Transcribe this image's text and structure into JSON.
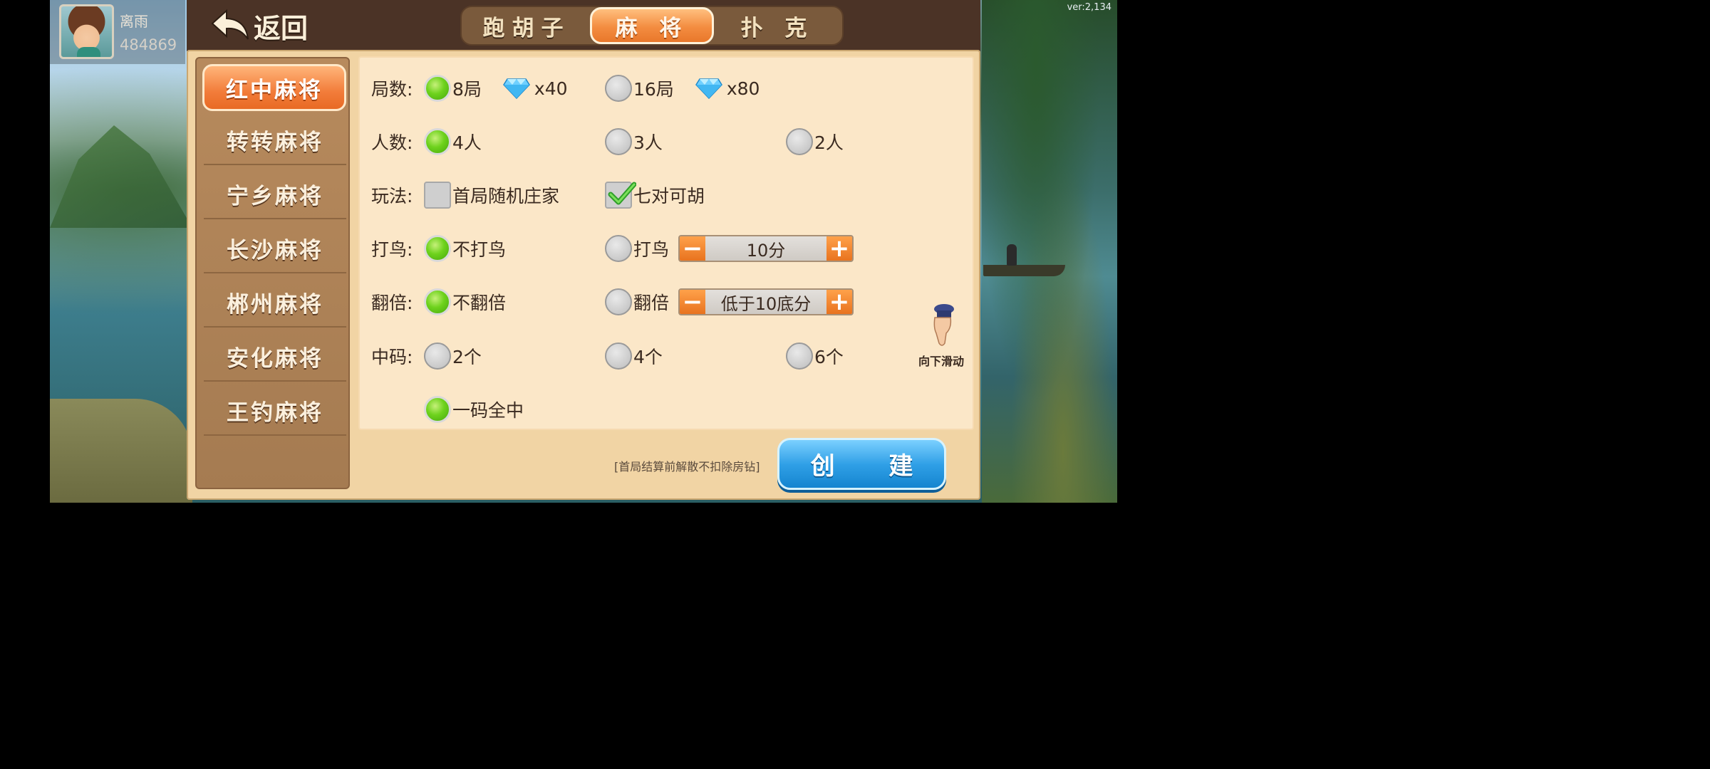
{
  "version": "ver:2,134",
  "player": {
    "name": "离雨",
    "id": "484869"
  },
  "header": {
    "back_label": "返回",
    "tabs": [
      {
        "label": "跑胡子",
        "active": false
      },
      {
        "label": "麻 将",
        "active": true
      },
      {
        "label": "扑 克",
        "active": false
      }
    ]
  },
  "sidebar": {
    "items": [
      {
        "label": "红中麻将",
        "active": true
      },
      {
        "label": "转转麻将",
        "active": false
      },
      {
        "label": "宁乡麻将",
        "active": false
      },
      {
        "label": "长沙麻将",
        "active": false
      },
      {
        "label": "郴州麻将",
        "active": false
      },
      {
        "label": "安化麻将",
        "active": false
      },
      {
        "label": "王钓麻将",
        "active": false
      }
    ]
  },
  "options": {
    "rounds": {
      "label": "局数:",
      "choices": [
        {
          "label": "8局",
          "cost": "x40",
          "selected": true
        },
        {
          "label": "16局",
          "cost": "x80",
          "selected": false
        }
      ]
    },
    "players": {
      "label": "人数:",
      "choices": [
        {
          "label": "4人",
          "selected": true
        },
        {
          "label": "3人",
          "selected": false
        },
        {
          "label": "2人",
          "selected": false
        }
      ]
    },
    "play": {
      "label": "玩法:",
      "choices": [
        {
          "label": "首局随机庄家",
          "checked": false
        },
        {
          "label": "七对可胡",
          "checked": true
        }
      ]
    },
    "bird": {
      "label": "打鸟:",
      "choices": [
        {
          "label": "不打鸟",
          "selected": true
        },
        {
          "label": "打鸟",
          "selected": false
        }
      ],
      "stepper_value": "10分"
    },
    "double": {
      "label": "翻倍:",
      "choices": [
        {
          "label": "不翻倍",
          "selected": true
        },
        {
          "label": "翻倍",
          "selected": false
        }
      ],
      "stepper_value": "低于10底分"
    },
    "zhongma": {
      "label": "中码:",
      "choices": [
        {
          "label": "2个",
          "selected": false
        },
        {
          "label": "4个",
          "selected": false
        },
        {
          "label": "6个",
          "selected": false
        },
        {
          "label": "一码全中",
          "selected": true
        }
      ]
    }
  },
  "scroll_hint": "向下滑动",
  "footer": {
    "notice": "[首局结算前解散不扣除房钻]",
    "create_label": "创 建"
  },
  "colors": {
    "accent_orange": "#f38c40",
    "create_blue": "#2f9fe6",
    "radio_green": "#6ed21d",
    "panel_bg": "#f1d4a4"
  }
}
